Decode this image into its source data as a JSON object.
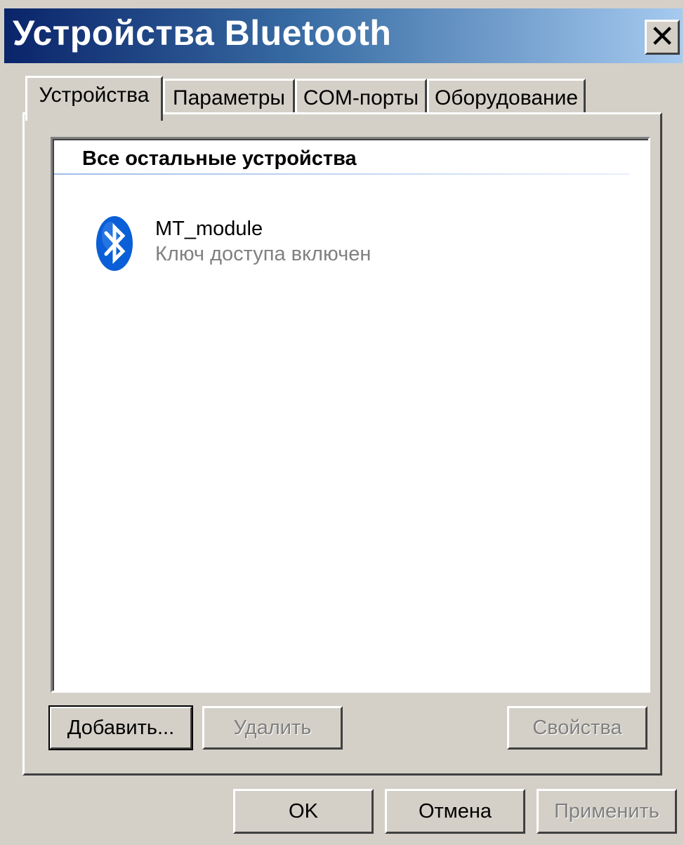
{
  "window": {
    "title": "Устройства Bluetooth",
    "close_glyph": "✕"
  },
  "tabs": [
    {
      "label": "Устройства",
      "active": true
    },
    {
      "label": "Параметры",
      "active": false
    },
    {
      "label": "COM-порты",
      "active": false
    },
    {
      "label": "Оборудование",
      "active": false
    }
  ],
  "device_list": {
    "group_header": "Все остальные устройства",
    "devices": [
      {
        "name": "MT_module",
        "status": "Ключ доступа включен",
        "icon": "bluetooth-icon"
      }
    ]
  },
  "panel_buttons": {
    "add": "Добавить...",
    "remove": "Удалить",
    "properties": "Свойства"
  },
  "dialog_buttons": {
    "ok": "OK",
    "cancel": "Отмена",
    "apply": "Применить"
  },
  "colors": {
    "title_gradient_start": "#0a246a",
    "title_gradient_end": "#a6caf0",
    "bluetooth_blue": "#0a5fd8",
    "disabled_text": "#808080"
  }
}
